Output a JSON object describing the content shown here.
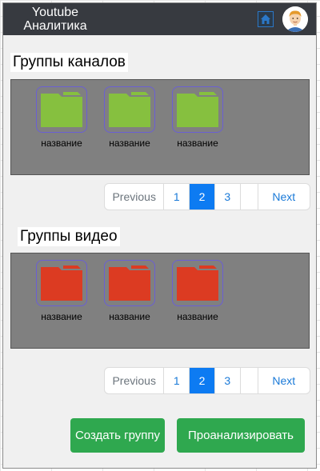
{
  "header": {
    "title": "Youtube\nАналитика"
  },
  "channel_groups": {
    "title": "Группы каналов",
    "color": "#86c03f",
    "folders": [
      {
        "label": "название"
      },
      {
        "label": "название"
      },
      {
        "label": "название"
      }
    ],
    "pagination": {
      "previous": "Previous",
      "pages": [
        "1",
        "2",
        "3"
      ],
      "active": "2",
      "next": "Next"
    }
  },
  "video_groups": {
    "title": "Группы видео",
    "color": "#dc3b22",
    "folders": [
      {
        "label": "название"
      },
      {
        "label": "название"
      },
      {
        "label": "название"
      }
    ],
    "pagination": {
      "previous": "Previous",
      "pages": [
        "1",
        "2",
        "3"
      ],
      "active": "2",
      "next": "Next"
    }
  },
  "actions": {
    "create_group": "Создать группу",
    "analyze": "Проанализировать"
  },
  "colors": {
    "header_bg": "#373a40",
    "button_green": "#2fa84f",
    "pager_active": "#0d7bf2"
  }
}
